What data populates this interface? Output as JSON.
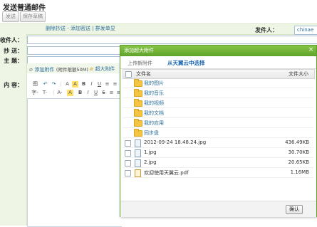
{
  "page": {
    "title": "发送普通邮件"
  },
  "toolbar": {
    "send_label": "发送",
    "save_draft_label": "保存草稿"
  },
  "header": {
    "links": "删除抄送 - 添加密送 | 群发单显",
    "sender_label": "发件人：",
    "sender_value": "chinae"
  },
  "form": {
    "to_label": "收件人：",
    "cc_label": "抄  送：",
    "subject_label": "主  题：",
    "content_label": "内  容：",
    "add_attachment": "添加附件",
    "attachment_limit": "(附件限额50M)",
    "super_attachment": "超大附件"
  },
  "editor": {
    "row1": [
      "图",
      "↶",
      "↷",
      "|",
      "A",
      "A",
      "B",
      "I",
      "U",
      "≡",
      "≡"
    ],
    "row2": [
      "字-",
      "T-",
      "|",
      "A-",
      "A",
      "B",
      "I",
      "U",
      "S",
      "≡",
      "≡"
    ]
  },
  "dialog": {
    "title": "添加超大附件",
    "close_glyph": "×",
    "tab_upload": "上传新附件",
    "tab_cloud": "从天翼云中选择",
    "col_name": "文件名",
    "col_size": "文件大小",
    "folders": [
      "我的图片",
      "我的音乐",
      "我的视频",
      "我的文档",
      "我的应用",
      "同步盘"
    ],
    "files": [
      {
        "name": "2012-09-24 18.48.24.jpg",
        "size": "436.49KB",
        "type": "image"
      },
      {
        "name": "1.jpg",
        "size": "30.70KB",
        "type": "image"
      },
      {
        "name": "2.jpg",
        "size": "20.65KB",
        "type": "image"
      },
      {
        "name": "欢迎使用天翼云.pdf",
        "size": "1.16MB",
        "type": "pdf"
      }
    ],
    "ok_label": "确认"
  },
  "colors": {
    "accent_green": "#5ea32a",
    "link_blue": "#2a6e9a",
    "folder_yellow": "#f4c542"
  }
}
